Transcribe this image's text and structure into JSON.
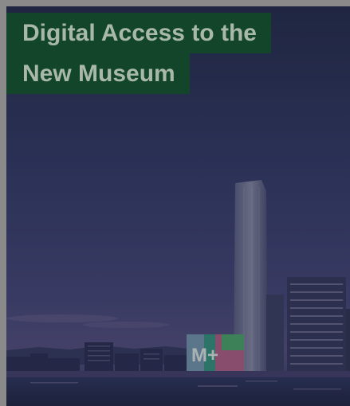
{
  "hero": {
    "title_line1": "Digital Access to the",
    "title_line2": "New Museum",
    "facade_logo": "M+"
  },
  "colors": {
    "title_background": "#12452a",
    "title_text": "#a9b9a9",
    "frame": "#8a8a8a"
  }
}
